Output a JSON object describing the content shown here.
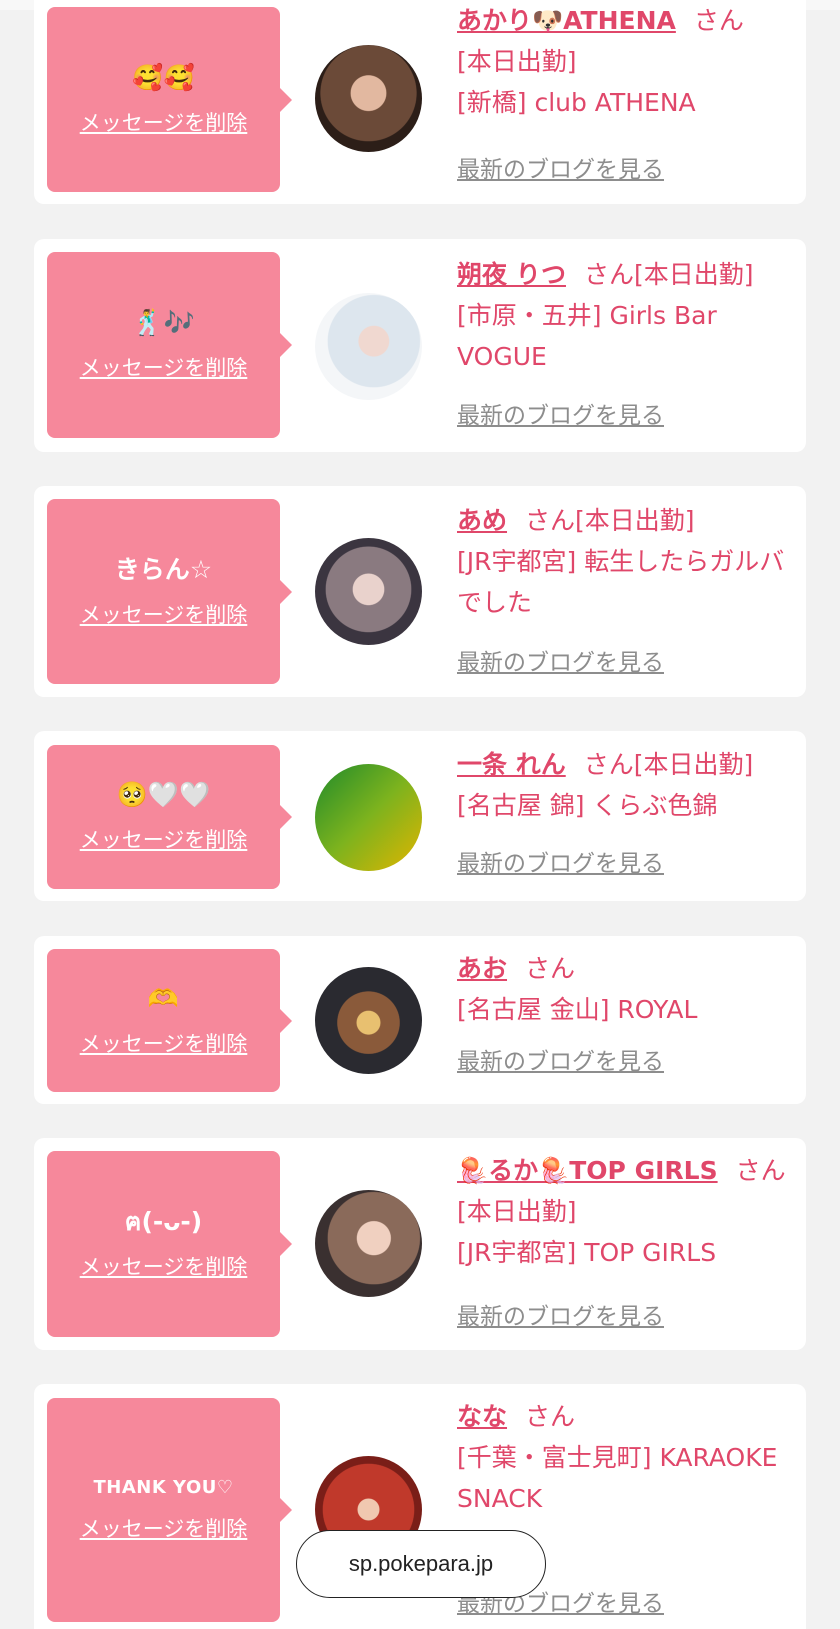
{
  "delete_label": "メッセージを削除",
  "blog_label": "最新のブログを見る",
  "san_label": "さん",
  "url_bar": {
    "host": "sp.pokepara.jp"
  },
  "colors": {
    "accent": "#e0476a",
    "bubble": "#f6889b",
    "link_gray": "#8d8d8d"
  },
  "cards": [
    {
      "message": "🥰🥰",
      "name": "あかり🐶ATHENA",
      "status": "[本日出勤]",
      "store": "[新橋] club ATHENA",
      "avatar_icon": "woman-portrait-avatar"
    },
    {
      "message": "🕺🎶",
      "name": "朔夜 りつ",
      "status": "[本日出勤]",
      "store": "[市原・五井] Girls Bar VOGUE",
      "avatar_icon": "woman-white-dress-avatar"
    },
    {
      "message": "きらん☆",
      "name": "あめ",
      "status": "[本日出勤]",
      "store": "[JR宇都宮] 転生したらガルバでした",
      "avatar_icon": "woman-selfie-avatar"
    },
    {
      "message": "🥺🤍🤍",
      "name": "一条 れん",
      "status": "[本日出勤]",
      "store": "[名古屋 錦] くらぶ色錦",
      "avatar_icon": "green-calligraphy-logo-avatar"
    },
    {
      "message": "🫶",
      "name": "あお",
      "status": "",
      "store": "[名古屋 金山] ROYAL",
      "avatar_icon": "night-storefront-avatar"
    },
    {
      "message": "ฅ(-ᴗ-)",
      "name": "🪼るか🪼TOP GIRLS",
      "status": "[本日出勤]",
      "store": "[JR宇都宮] TOP GIRLS",
      "avatar_icon": "woman-portrait-avatar"
    },
    {
      "message": "THANK YOU♡",
      "name": "なな",
      "status": "",
      "store": "[千葉・富士見町] KARAOKE SNACK",
      "avatar_icon": "red-interior-avatar"
    }
  ]
}
